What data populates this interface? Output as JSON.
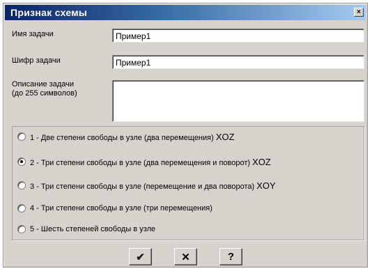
{
  "window": {
    "title": "Признак схемы",
    "close_glyph": "×"
  },
  "form": {
    "task_name_label": "Имя задачи",
    "task_name_value": "Пример1",
    "task_code_label": "Шифр задачи",
    "task_code_value": "Пример1",
    "description_label_line1": "Описание задачи",
    "description_label_line2": "(до 255 символов)",
    "description_value": ""
  },
  "scheme_options": [
    {
      "text": "1 - Две степени свободы в узле (два перемещения) ",
      "plane": "XOZ",
      "checked": false
    },
    {
      "text": "2 - Три степени свободы в узле (два перемещения и поворот) ",
      "plane": "XOZ",
      "checked": true
    },
    {
      "text": "3 - Три степени свободы в узле (перемещение и два поворота) ",
      "plane": "XOY",
      "checked": false
    },
    {
      "text": "4 - Три степени свободы в узле (три перемещения)",
      "plane": "",
      "checked": false
    },
    {
      "text": "5 - Шесть степеней свободы в узле",
      "plane": "",
      "checked": false
    }
  ],
  "buttons": {
    "ok_icon": "check-icon",
    "ok_glyph": "✔",
    "cancel_icon": "cross-icon",
    "cancel_glyph": "✕",
    "help_icon": "question-icon",
    "help_glyph": "?"
  }
}
